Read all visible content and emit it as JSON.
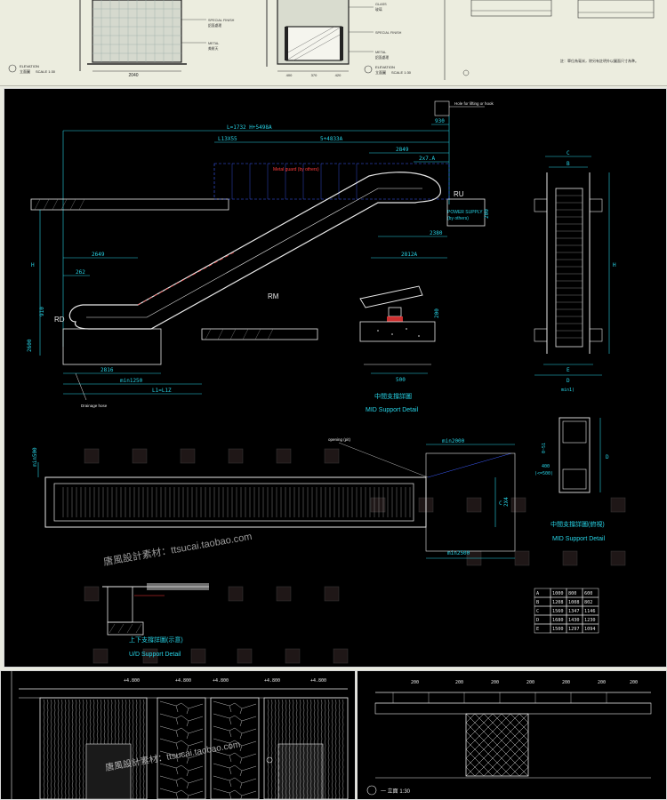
{
  "top_strip": {
    "elevation_left": {
      "title": "ELEVATION",
      "cn": "立面圖",
      "scale": "SCALE 1:30",
      "width_dim": "2040"
    },
    "callouts_left": [
      "SPECIAL FINISH",
      "METAL",
      "鋁面處理",
      "美術天"
    ],
    "elevation_mid": {
      "title": "ELEVATION",
      "cn": "立面圖",
      "scale": "SCALE 1:30",
      "dims": [
        "400",
        "370",
        "420"
      ]
    },
    "callouts_mid": [
      "GLASS",
      "SPECIAL FINISH",
      "METAL",
      "鋁面處理",
      "玻璃"
    ],
    "note_right": "註：單位為毫米，除另有註明外以圖面尺寸為準。"
  },
  "main": {
    "escalator_side": {
      "top_dims": [
        "L=1732 H+5498A",
        "L13X55",
        "5+4833A",
        "2849",
        "2x7.A",
        "930"
      ],
      "left_labels": [
        "2649",
        "262",
        "910",
        "2600",
        "H"
      ],
      "bottom_dims": [
        "2816",
        "min1250",
        "L1=L1Z"
      ],
      "labels": {
        "ru": "RU",
        "rd": "RD",
        "rm": "RM"
      },
      "annotations": [
        "POWER SUPPLY",
        "(by others)",
        "Hole for lifting or hook",
        "Drainage hose",
        "Metal guard (by others)"
      ],
      "side_dims": [
        "2380",
        "2812A",
        "200"
      ]
    },
    "section_view": {
      "dims": [
        "B",
        "C",
        "H",
        "E",
        "D"
      ],
      "label_bottom": "min1)"
    },
    "mid_support": {
      "cn": "中間支撐詳圖",
      "en": "MID Support Detail",
      "dims": [
        "200",
        "500"
      ]
    },
    "plan_view": {
      "dims": [
        "min2000",
        "min2500",
        "min500",
        "C",
        "2X4"
      ],
      "label": "opening (pit)"
    },
    "mid_support_plan": {
      "cn": "中間支撐詳圖(俯視)",
      "en": "MID Support Detail",
      "dims": [
        "D",
        "400",
        "(<=500)",
        "0~51"
      ]
    },
    "ud_support": {
      "cn": "上下支撐詳圖(示意)",
      "en": "U/D Support Detail"
    },
    "table": {
      "rows": [
        [
          "A",
          "1000",
          "800",
          "600"
        ],
        [
          "B",
          "1208",
          "1008",
          "802"
        ],
        [
          "C",
          "1560",
          "1347",
          "1146"
        ],
        [
          "D",
          "1680",
          "1430",
          "1230"
        ],
        [
          "E",
          "1500",
          "1297",
          "1094"
        ]
      ]
    },
    "watermark": "唐風設計素材：ttsucai.taobao.com"
  },
  "bottom_left": {
    "dims": [
      "+4.800",
      "+4.800",
      "+4.800",
      "+4.800",
      "+4.800"
    ],
    "watermark": "唐風設計素材：ttsucai.taobao.com"
  },
  "bottom_right": {
    "caption": "一 立面 1:30",
    "dims": [
      "200",
      "200",
      "200",
      "200",
      "200",
      "200",
      "200"
    ]
  },
  "colors": {
    "cad_bg": "#000000",
    "line_white": "#e8e8e8",
    "dim_cyan": "#27d3e6",
    "annot_blue": "#3c5cff",
    "annot_red": "#ff3b3b",
    "paper": "#eceddf"
  }
}
